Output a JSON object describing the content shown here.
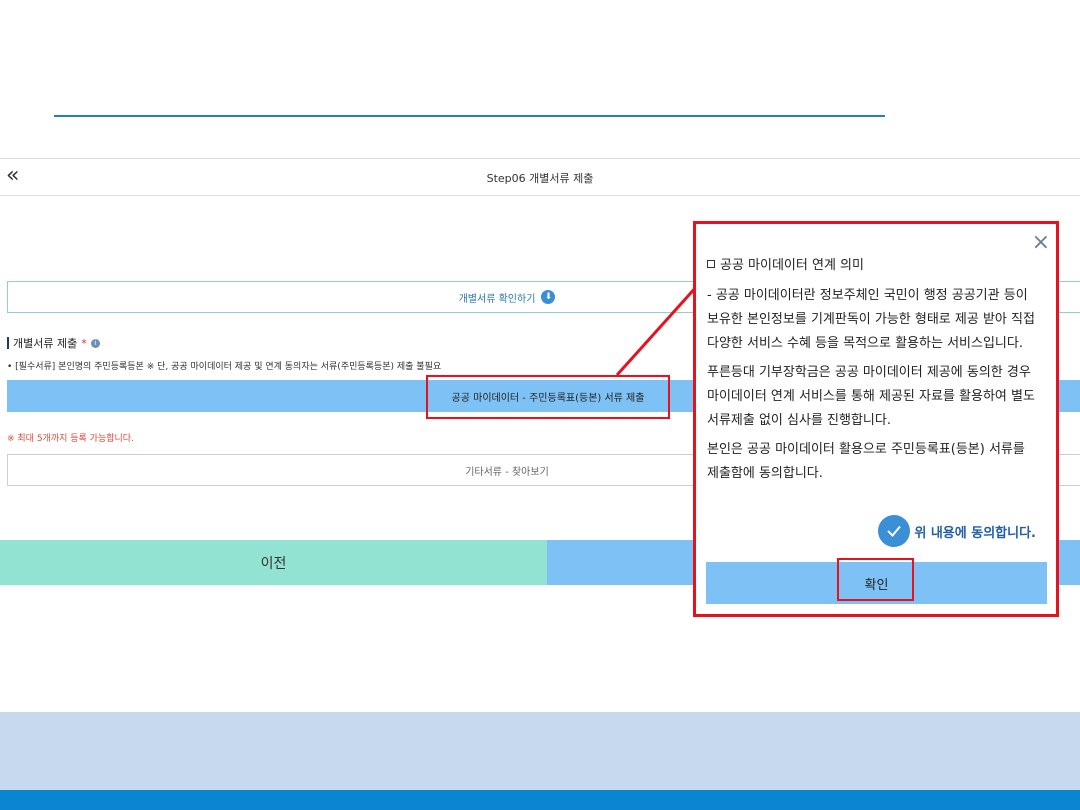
{
  "header": {
    "title": "Step06 개별서류 제출",
    "back_icon": "«"
  },
  "buttons": {
    "check_docs": "개별서류 확인하기",
    "submit_mydata": "공공 마이데이터 - 주민등록표(등본) 서류 제출",
    "other_docs": "기타서류 - 찾아보기",
    "prev": "이전"
  },
  "section": {
    "title": "개별서류 제출",
    "required_mark": "*",
    "notice": "• [필수서류] 본인명의 주민등록등본 ※ 단, 공공 마이데이터 제공 및 연계 동의자는 서류(주민등록등본) 제출 불필요",
    "max_note": "※ 최대 5개까지 등록 가능합니다."
  },
  "modal": {
    "heading": "공공 마이데이터 연계 의미",
    "paragraphs": [
      "- 공공 마이데이터란 정보주체인 국민이 행정 공공기관 등이 보유한 본인정보를 기계판독이 가능한 형태로 제공 받아 직접 다양한 서비스 수혜 등을 목적으로 활용하는 서비스입니다.",
      "푸른등대 기부장학금은 공공 마이데이터 제공에 동의한 경우 마이데이터 연계 서비스를 통해 제공된 자료를 활용하여 별도 서류제출 없이 심사를 진행합니다.",
      "본인은 공공 마이데이터 활용으로 주민등록표(등본) 서류를 제출함에 동의합니다."
    ],
    "agree_label": "위 내용에 동의합니다.",
    "confirm_label": "확인",
    "close_icon": "×"
  },
  "colors": {
    "accent_blue": "#7ec2f5",
    "mint": "#92e3d2",
    "highlight_red": "#e8121e",
    "footer_light": "#c7d9ef",
    "footer_dark": "#0a86d0"
  },
  "icons": {
    "download": "⬇",
    "info": "i",
    "check": "check-icon"
  }
}
